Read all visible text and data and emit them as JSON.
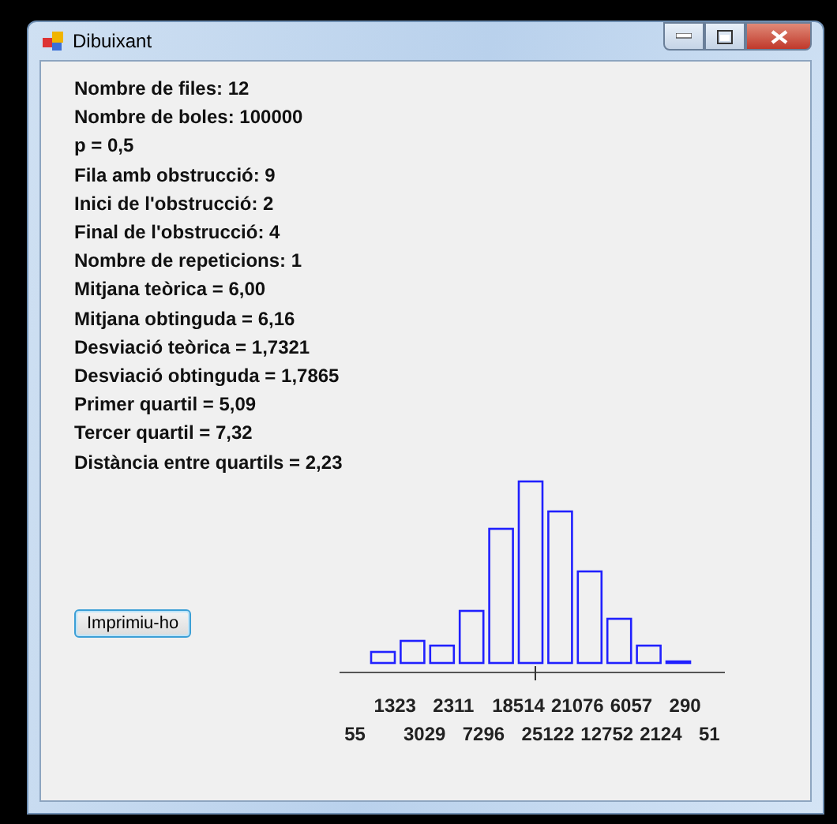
{
  "window": {
    "title": "Dibuixant"
  },
  "stats": [
    "Nombre de files: 12",
    "Nombre de boles: 100000",
    "p = 0,5",
    "Fila amb obstrucció: 9",
    "Inici de l'obstrucció: 2",
    "Final de l'obstrucció: 4",
    "Nombre de repeticions: 1",
    "Mitjana teòrica = 6,00",
    "Mitjana obtinguda = 6,16",
    "Desviació teòrica = 1,7321",
    "Desviació obtinguda = 1,7865",
    "Primer quartil = 5,09",
    "Tercer quartil = 7,32",
    "Distància entre quartils = 2,23"
  ],
  "button": "Imprimiu-ho",
  "counts": [
    "55",
    "1323",
    "3029",
    "2311",
    "7296",
    "18514",
    "25122",
    "21076",
    "12752",
    "6057",
    "2124",
    "290",
    "51"
  ]
}
